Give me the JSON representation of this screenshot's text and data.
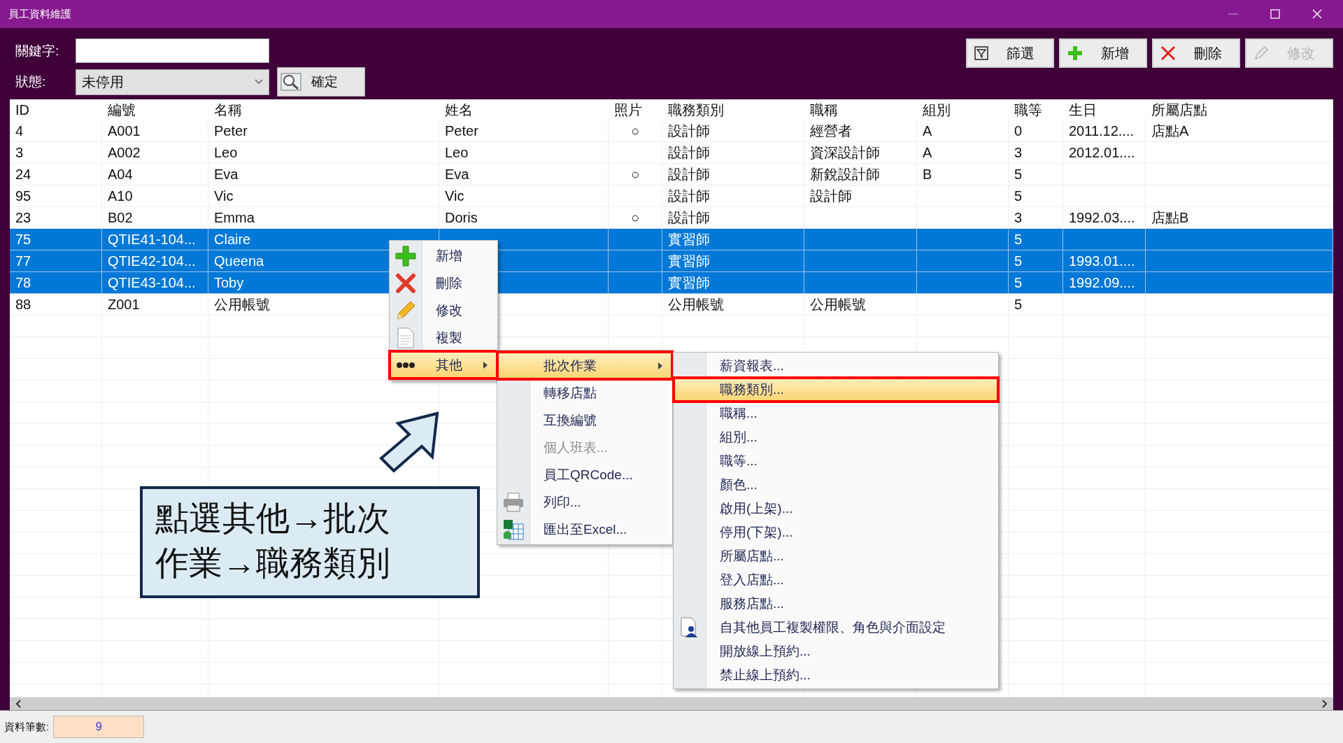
{
  "window": {
    "title": "員工資料維護"
  },
  "search": {
    "keyword_label": "關鍵字:",
    "status_label": "狀態:",
    "status_value": "未停用",
    "confirm_button": "確定"
  },
  "toolbar": [
    {
      "label": "篩選",
      "kind": "filter",
      "disabled": false
    },
    {
      "label": "新增",
      "kind": "add",
      "disabled": false
    },
    {
      "label": "刪除",
      "kind": "delete",
      "disabled": false
    },
    {
      "label": "修改",
      "kind": "edit",
      "disabled": true
    }
  ],
  "table": {
    "columns": [
      "ID",
      "編號",
      "名稱",
      "姓名",
      "照片",
      "職務類別",
      "職稱",
      "組別",
      "職等",
      "生日",
      "所屬店點"
    ],
    "rows": [
      {
        "cells": [
          "4",
          "A001",
          "Peter",
          "Peter",
          "○",
          "設計師",
          "經營者",
          "A",
          "0",
          "2011.12....",
          "店點A"
        ],
        "selected": false
      },
      {
        "cells": [
          "3",
          "A002",
          "Leo",
          "Leo",
          null,
          "設計師",
          "資深設計師",
          "A",
          "3",
          "2012.01....",
          null
        ],
        "selected": false
      },
      {
        "cells": [
          "24",
          "A04",
          "Eva",
          "Eva",
          "○",
          "設計師",
          "新銳設計師",
          "B",
          "5",
          null,
          null
        ],
        "selected": false
      },
      {
        "cells": [
          "95",
          "A10",
          "Vic",
          "Vic",
          null,
          "設計師",
          "設計師",
          null,
          "5",
          null,
          null
        ],
        "selected": false
      },
      {
        "cells": [
          "23",
          "B02",
          "Emma",
          "Doris",
          "○",
          "設計師",
          null,
          null,
          "3",
          "1992.03....",
          "店點B"
        ],
        "selected": false
      },
      {
        "cells": [
          "75",
          "QTIE41-104...",
          "Claire",
          null,
          null,
          "實習師",
          null,
          null,
          "5",
          null,
          null
        ],
        "selected": true
      },
      {
        "cells": [
          "77",
          "QTIE42-104...",
          "Queena",
          null,
          null,
          "實習師",
          null,
          null,
          "5",
          "1993.01....",
          null
        ],
        "selected": true
      },
      {
        "cells": [
          "78",
          "QTIE43-104...",
          "Toby",
          null,
          null,
          "實習師",
          null,
          null,
          "5",
          "1992.09....",
          null
        ],
        "selected": true
      },
      {
        "cells": [
          "88",
          "Z001",
          "公用帳號",
          null,
          null,
          "公用帳號",
          "公用帳號",
          null,
          "5",
          null,
          null
        ],
        "selected": false
      }
    ]
  },
  "footer": {
    "label": "資料筆數:",
    "count": "9"
  },
  "context_menu": {
    "items": [
      {
        "label": "新增",
        "kind": "add",
        "selected": false,
        "submenu": false
      },
      {
        "label": "刪除",
        "kind": "delete",
        "selected": false,
        "submenu": false
      },
      {
        "label": "修改",
        "kind": "edit",
        "selected": false,
        "submenu": false
      },
      {
        "label": "複製",
        "kind": "copy",
        "selected": false,
        "submenu": false
      },
      {
        "label": "其他",
        "kind": "more",
        "selected": true,
        "submenu": true
      }
    ]
  },
  "other_menu": {
    "items": [
      {
        "label": "批次作業",
        "selected": true,
        "submenu": true,
        "disabled": false
      },
      {
        "label": "轉移店點",
        "selected": false,
        "submenu": false,
        "disabled": false
      },
      {
        "label": "互換編號",
        "selected": false,
        "submenu": false,
        "disabled": false
      },
      {
        "label": "個人班表...",
        "selected": false,
        "submenu": false,
        "disabled": true
      },
      {
        "label": "員工QRCode...",
        "selected": false,
        "submenu": false,
        "disabled": false
      },
      {
        "label": "列印...",
        "kind": "print",
        "selected": false,
        "submenu": false,
        "disabled": false
      },
      {
        "label": "匯出至Excel...",
        "kind": "excel",
        "selected": false,
        "submenu": false,
        "disabled": false
      }
    ]
  },
  "batch_menu": {
    "items": [
      {
        "label": "薪資報表...",
        "selected": false
      },
      {
        "label": "職務類別...",
        "selected": true
      },
      {
        "label": "職稱...",
        "selected": false
      },
      {
        "label": "組別...",
        "selected": false
      },
      {
        "label": "職等...",
        "selected": false
      },
      {
        "label": "顏色...",
        "selected": false
      },
      {
        "label": "啟用(上架)...",
        "selected": false
      },
      {
        "label": "停用(下架)...",
        "selected": false
      },
      {
        "label": "所屬店點...",
        "selected": false
      },
      {
        "label": "登入店點...",
        "selected": false
      },
      {
        "label": "服務店點...",
        "selected": false
      },
      {
        "label": "自其他員工複製權限、角色與介面設定",
        "kind": "user-copy",
        "selected": false
      },
      {
        "label": "開放線上預約...",
        "selected": false
      },
      {
        "label": "禁止線上預約...",
        "selected": false
      }
    ]
  },
  "callout": {
    "lines": [
      "點選其他→批次",
      "作業→職務類別"
    ]
  }
}
